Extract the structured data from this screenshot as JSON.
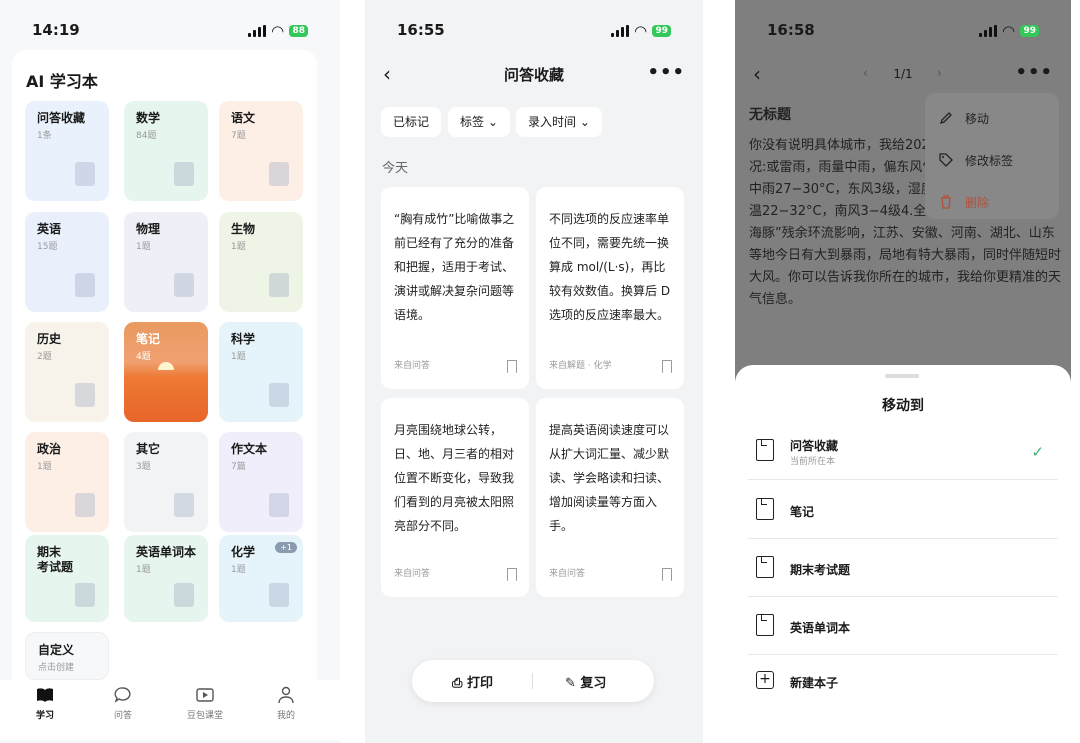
{
  "panel1": {
    "status": {
      "time": "14:19",
      "battery": "88"
    },
    "title": "AI 学习本",
    "tiles": [
      {
        "name": "问答收藏",
        "sub": "1条",
        "bg": "#e9f1fd",
        "icon": "bookmark-icon"
      },
      {
        "name": "数学",
        "sub": "84题",
        "bg": "#e6f5ee",
        "icon": "sailboat-icon"
      },
      {
        "name": "语文",
        "sub": "7题",
        "bg": "#fdeee6",
        "icon": "fan-icon"
      },
      {
        "name": "英语",
        "sub": "15题",
        "bg": "#e9f0fc",
        "icon": "scroll-icon"
      },
      {
        "name": "物理",
        "sub": "1题",
        "bg": "#efeff8",
        "icon": "apple-icon"
      },
      {
        "name": "生物",
        "sub": "1题",
        "bg": "#eef4e6",
        "icon": "leaf-icon"
      },
      {
        "name": "历史",
        "sub": "2题",
        "bg": "#f8f3ea",
        "icon": "jar-icon"
      },
      {
        "name": "笔记",
        "sub": "4题",
        "bg": "#f09050",
        "icon": "sunset-icon"
      },
      {
        "name": "科学",
        "sub": "1题",
        "bg": "#e5f3fa",
        "icon": "microscope-icon"
      },
      {
        "name": "政治",
        "sub": "1题",
        "bg": "#fdeee6",
        "icon": "chess-knight-icon"
      },
      {
        "name": "其它",
        "sub": "3题",
        "bg": "#f2f3f5",
        "icon": "sparkle-icon"
      },
      {
        "name": "作文本",
        "sub": "7篇",
        "bg": "#f0eefa",
        "icon": "pen-icon"
      },
      {
        "name": "期末\n考试题",
        "sub": "",
        "bg": "#e6f5ee",
        "icon": "sailboat-icon"
      },
      {
        "name": "英语单词本",
        "sub": "1题",
        "bg": "#e6f5ee",
        "icon": "dictionary-icon"
      },
      {
        "name": "化学",
        "sub": "1题",
        "bg": "#e5f3fa",
        "icon": "flask-icon",
        "badge": "+1"
      },
      {
        "name": "自定义",
        "sub": "点击创建",
        "bg": "#f7f8fa",
        "icon": ""
      }
    ],
    "tabs": [
      {
        "label": "学习",
        "icon": "book-icon"
      },
      {
        "label": "问答",
        "icon": "chat-icon"
      },
      {
        "label": "豆包课堂",
        "icon": "play-icon"
      },
      {
        "label": "我的",
        "icon": "person-icon"
      }
    ]
  },
  "panel2": {
    "status": {
      "time": "16:55",
      "battery": "99"
    },
    "title": "问答收藏",
    "filters": [
      "已标记",
      "标签 ⌄",
      "录入时间 ⌄"
    ],
    "section": "今天",
    "cards": [
      {
        "text": "“胸有成竹”比喻做事之前已经有了充分的准备和把握，适用于考试、演讲或解决复杂问题等语境。",
        "source": "来自问答"
      },
      {
        "text": "不同选项的反应速率单位不同，需要先统一换算成 mol/(L·s)，再比较有效数值。换算后 D 选项的反应速率最大。",
        "source": "来自解题 · 化学"
      },
      {
        "text": "月亮围绕地球公转，日、地、月三者的相对位置不断变化，导致我们看到的月亮被太阳照亮部分不同。",
        "source": "来自问答"
      },
      {
        "text": "提高英语阅读速度可以从扩大词汇量、减少默读、学会略读和扫读、增加阅读量等方面入手。",
        "source": "来自问答"
      }
    ],
    "print_label": "打印",
    "review_label": "复习"
  },
  "panel3": {
    "status": {
      "time": "16:58",
      "battery": "99"
    },
    "pager": "1/1",
    "doc_title": "无标题",
    "doc_text": "你没有说明具体城市，我给2026年8月11日的天气情况:或雷雨，雨量中雨，偏东风气温25−28°C2.杭州：中雨27−30°C，东风3级，湿度大3.沈阳：多云，气温22−32°C，南风3−4级4.全国大范围：受台风“白海豚”残余环流影响，江苏、安徽、河南、湖北、山东等地今日有大到暴雨，局地有特大暴雨，同时伴随短时大风。你可以告诉我你所在的城市，我给你更精准的天气信息。",
    "menu": [
      {
        "label": "移动",
        "icon": "pencil-icon",
        "color": "#222"
      },
      {
        "label": "修改标签",
        "icon": "tag-icon",
        "color": "#222"
      },
      {
        "label": "删除",
        "icon": "trash-icon",
        "color": "#b0523c"
      }
    ],
    "sheet_title": "移动到",
    "targets": [
      {
        "label": "问答收藏",
        "sub": "当前所在本",
        "selected": true
      },
      {
        "label": "笔记",
        "sub": ""
      },
      {
        "label": "期末考试题",
        "sub": ""
      },
      {
        "label": "英语单词本",
        "sub": ""
      }
    ],
    "new_label": "新建本子"
  }
}
